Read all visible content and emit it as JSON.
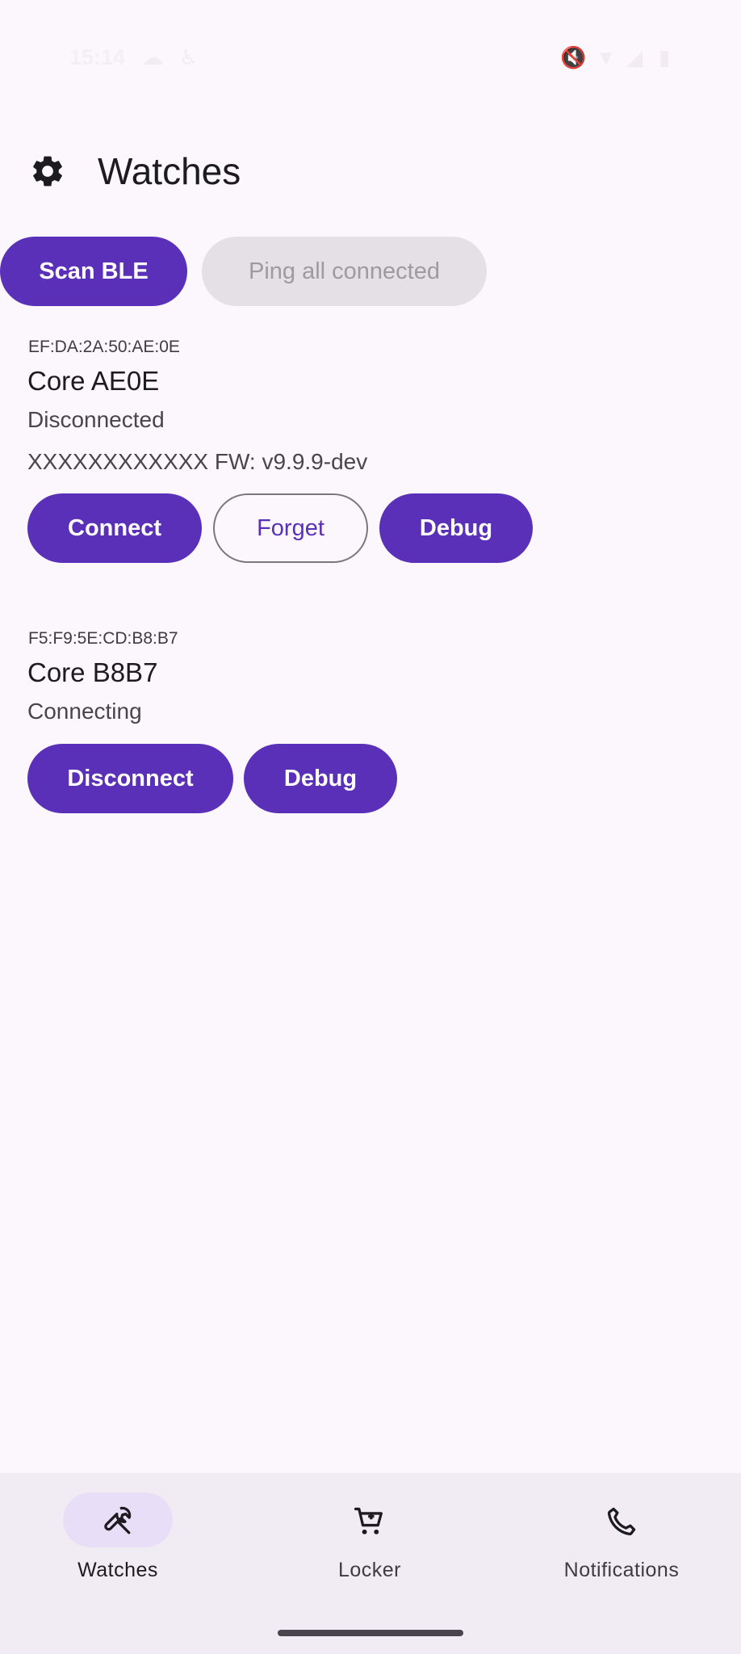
{
  "status_bar": {
    "time": "15:14",
    "icons": [
      "cloud-icon",
      "accessibility-icon",
      "mute-icon",
      "wifi-icon",
      "signal-icon",
      "battery-icon"
    ]
  },
  "header": {
    "title": "Watches",
    "icon": "gear-icon"
  },
  "toolbar": {
    "scan_label": "Scan BLE",
    "ping_label": "Ping all connected"
  },
  "devices": [
    {
      "mac": "EF:DA:2A:50:AE:0E",
      "name": "Core AE0E",
      "status": "Disconnected",
      "firmware": "XXXXXXXXXXXX FW: v9.9.9-dev",
      "actions": [
        "Connect",
        "Forget",
        "Debug"
      ]
    },
    {
      "mac": "F5:F9:5E:CD:B8:B7",
      "name": "Core B8B7",
      "status": "Connecting",
      "actions": [
        "Disconnect",
        "Debug"
      ]
    }
  ],
  "bottom_nav": {
    "items": [
      {
        "label": "Watches",
        "icon": "wrench-icon",
        "active": true
      },
      {
        "label": "Locker",
        "icon": "cart-icon",
        "active": false
      },
      {
        "label": "Notifications",
        "icon": "phone-icon",
        "active": false
      }
    ]
  },
  "colors": {
    "primary": "#5b30b8",
    "background": "#fcf7fc",
    "nav_background": "#f1ecf3",
    "nav_indicator": "#e8def8",
    "disabled": "#e4e0e6"
  }
}
